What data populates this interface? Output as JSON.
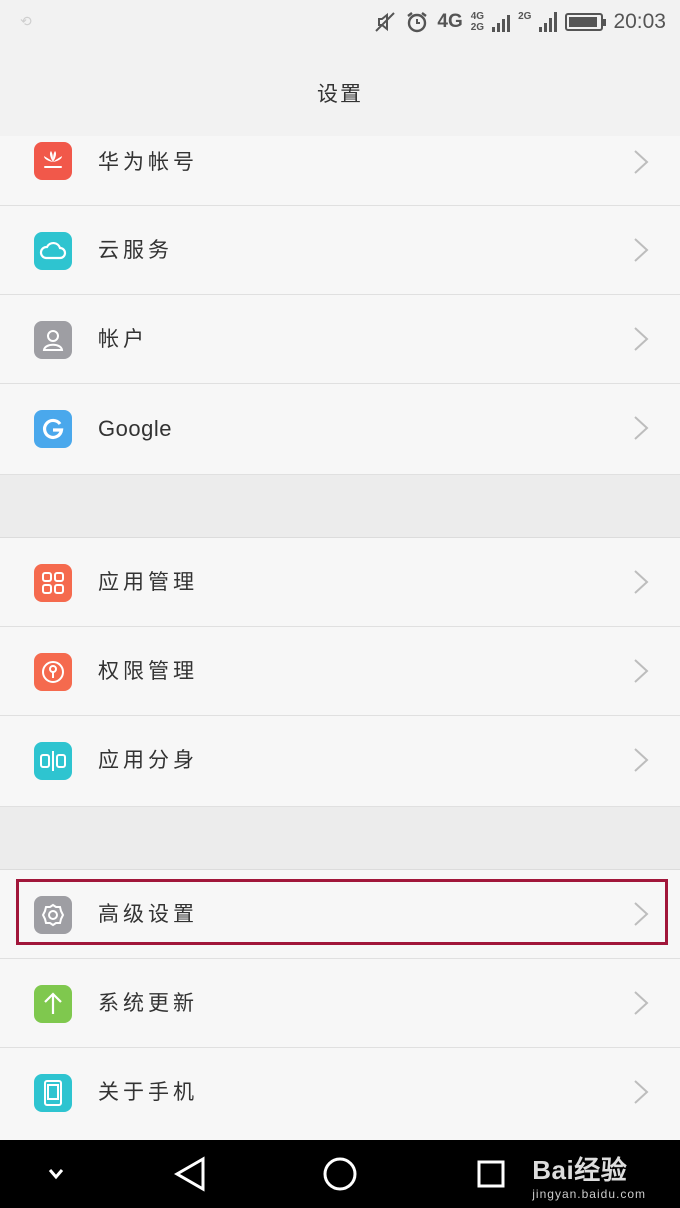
{
  "status_bar": {
    "network": "4G",
    "sim1": [
      "4G",
      "2G"
    ],
    "sim2": "2G",
    "battery_level": 0.8,
    "time": "20:03"
  },
  "header": {
    "title": "设置"
  },
  "sections": [
    [
      {
        "label": "华为帐号",
        "icon": "huawei-icon",
        "color": "#f1584a"
      },
      {
        "label": "云服务",
        "icon": "cloud-icon",
        "color": "#2ec4d0"
      },
      {
        "label": "帐户",
        "icon": "account-icon",
        "color": "#9e9ea3"
      },
      {
        "label": "Google",
        "icon": "google-icon",
        "color": "#4aa8ec"
      }
    ],
    [
      {
        "label": "应用管理",
        "icon": "app-grid-icon",
        "color": "#f56a4e"
      },
      {
        "label": "权限管理",
        "icon": "permission-lock-icon",
        "color": "#f56a4e"
      },
      {
        "label": "应用分身",
        "icon": "app-twin-icon",
        "color": "#2ec4d0"
      }
    ],
    [
      {
        "label": "高级设置",
        "icon": "gear-icon",
        "color": "#9e9ea3"
      },
      {
        "label": "系统更新",
        "icon": "update-arrow-icon",
        "color": "#7fc84e"
      },
      {
        "label": "关于手机",
        "icon": "phone-icon",
        "color": "#2ec4d0"
      }
    ]
  ],
  "highlight_color": "#a1163a",
  "navbar": {
    "buttons": [
      "chevron-down-icon",
      "back-triangle-icon",
      "home-circle-icon",
      "recent-square-icon"
    ]
  },
  "watermark": {
    "brand": "Bai经验",
    "url": "jingyan.baidu.com"
  }
}
